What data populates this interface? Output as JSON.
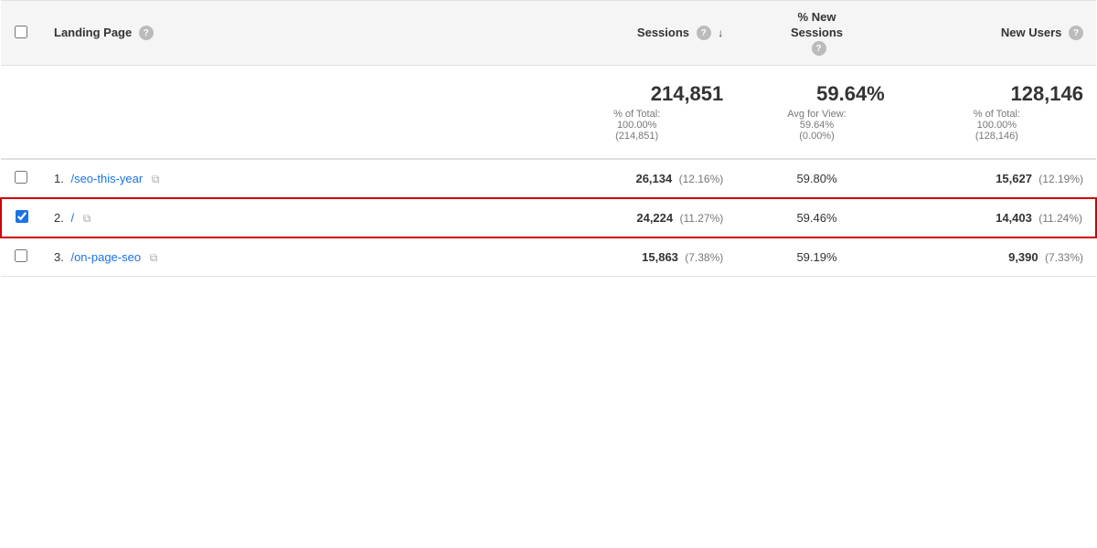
{
  "header": {
    "checkbox_col": "",
    "landing_page_label": "Landing Page",
    "sessions_label": "Sessions",
    "new_sessions_label": "% New\nSessions",
    "new_users_label": "New Users"
  },
  "summary": {
    "sessions_value": "214,851",
    "sessions_sub1": "% of Total:",
    "sessions_sub2": "100.00%",
    "sessions_sub3": "(214,851)",
    "new_sessions_value": "59.64%",
    "new_sessions_sub1": "Avg for View:",
    "new_sessions_sub2": "59.64%",
    "new_sessions_sub3": "(0.00%)",
    "new_users_value": "128,146",
    "new_users_sub1": "% of Total:",
    "new_users_sub2": "100.00%",
    "new_users_sub3": "(128,146)"
  },
  "rows": [
    {
      "num": "1.",
      "page": "/seo-this-year",
      "sessions": "26,134",
      "sessions_pct": "(12.16%)",
      "new_sessions": "59.80%",
      "new_users": "15,627",
      "new_users_pct": "(12.19%)",
      "selected": false
    },
    {
      "num": "2.",
      "page": "/",
      "sessions": "24,224",
      "sessions_pct": "(11.27%)",
      "new_sessions": "59.46%",
      "new_users": "14,403",
      "new_users_pct": "(11.24%)",
      "selected": true
    },
    {
      "num": "3.",
      "page": "/on-page-seo",
      "sessions": "15,863",
      "sessions_pct": "(7.38%)",
      "new_sessions": "59.19%",
      "new_users": "9,390",
      "new_users_pct": "(7.33%)",
      "selected": false
    }
  ],
  "icons": {
    "help": "?",
    "sort_down": "↓",
    "copy": "⧉"
  }
}
